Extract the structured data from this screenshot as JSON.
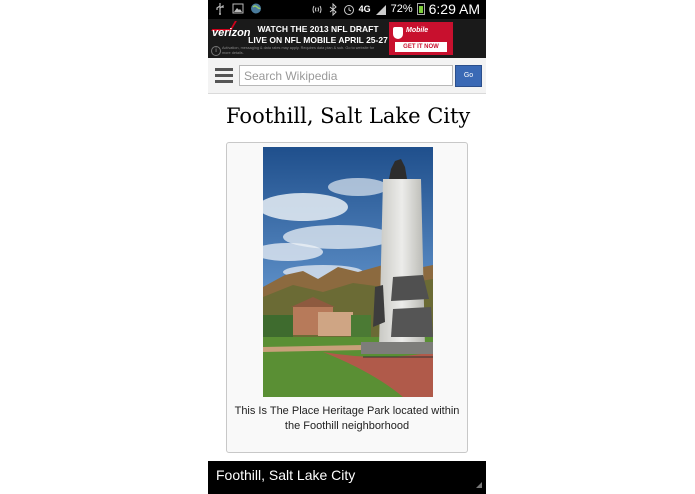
{
  "status_bar": {
    "network": "4G",
    "battery": "72%",
    "time": "6:29 AM"
  },
  "ad": {
    "brand": "verizon",
    "headline": "WATCH THE 2013 NFL DRAFT LIVE ON NFL MOBILE APRIL 25-27",
    "fine_print": "Activation, messaging & data rates may apply. Requires data plan & sub. Go to website for more details.",
    "product": "Mobile",
    "cta": "GET IT NOW"
  },
  "header": {
    "search_placeholder": "Search Wikipedia",
    "go_label": "Go"
  },
  "article": {
    "title": "Foothill, Salt Lake City",
    "image_caption": "This Is The Place Heritage Park located within the Foothill neighborhood"
  },
  "bottom_bar": {
    "title": "Foothill, Salt Lake City"
  },
  "colors": {
    "go_button": "#3a69b5",
    "ad_red": "#c8102e",
    "status_bar": "#000000"
  }
}
